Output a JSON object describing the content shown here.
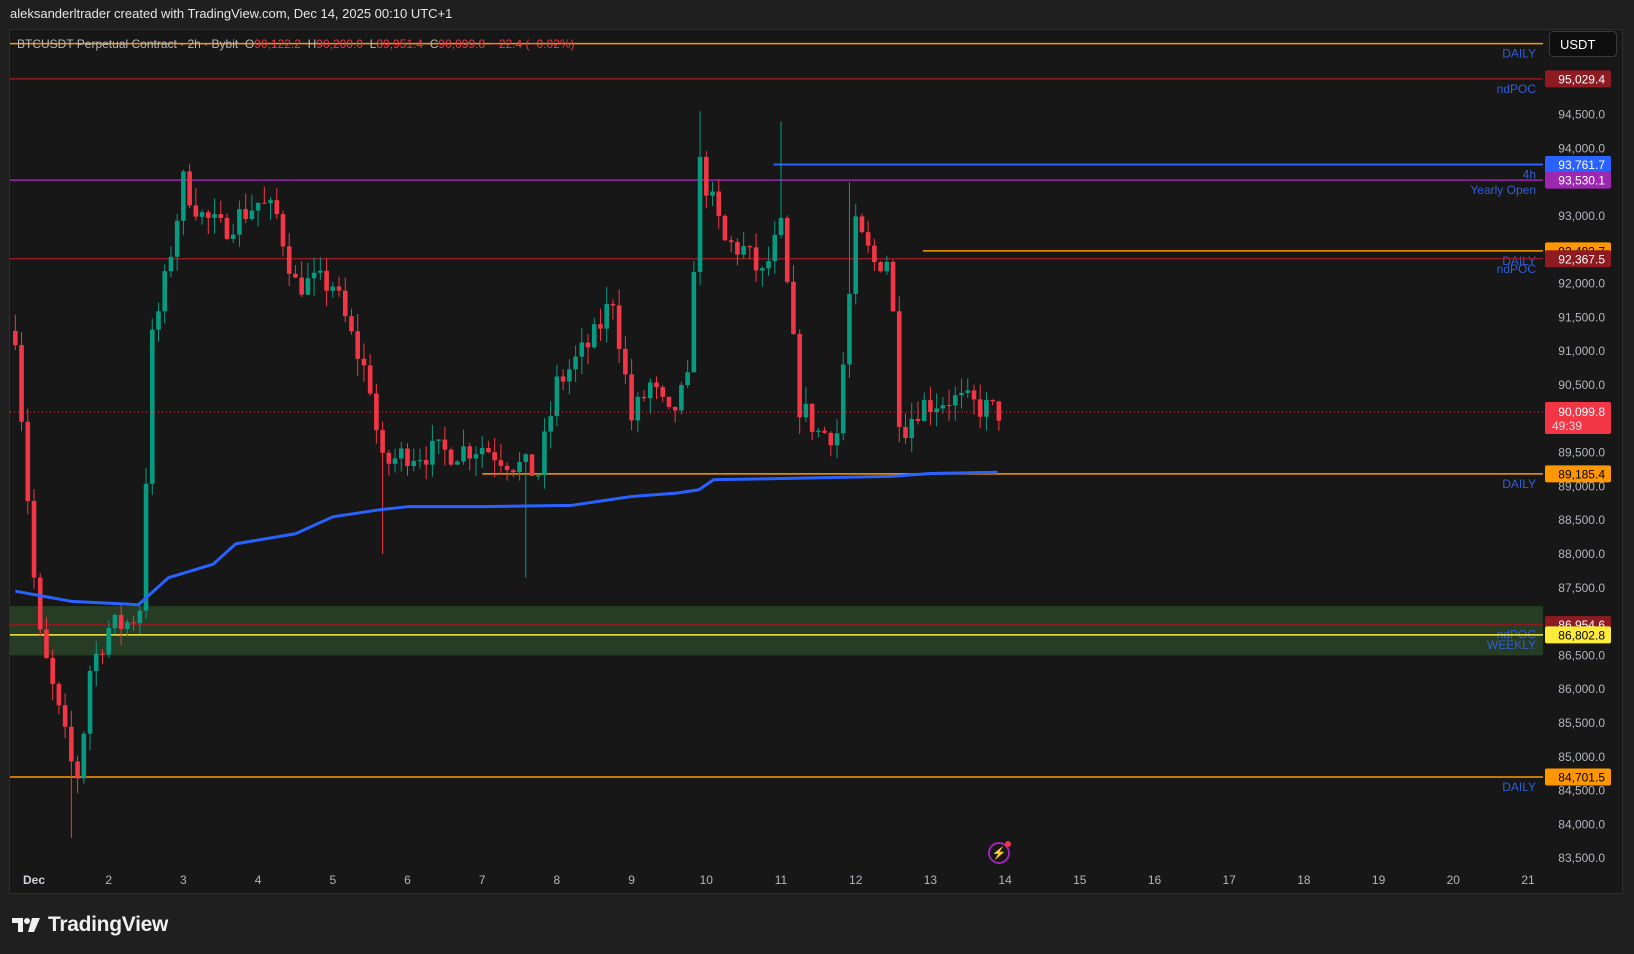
{
  "attribution": "aleksanderltrader created with TradingView.com, Dec 14, 2025 00:10 UTC+1",
  "legend": {
    "symbol": "BTCUSDT Perpetual Contract · 2h · Bybit",
    "o_label": "O",
    "o": "90,122.2",
    "h_label": "H",
    "h": "90,200.0",
    "l_label": "L",
    "l": "89,951.4",
    "c_label": "C",
    "c": "90,099.8",
    "change": "−22.4 (−0.02%)"
  },
  "currency": "USDT",
  "price_axis": [
    "94,500.0",
    "94,000.0",
    "93,500.0",
    "93,000.0",
    "92,500.0",
    "92,000.0",
    "91,500.0",
    "91,000.0",
    "90,500.0",
    "90,000.0",
    "89,500.0",
    "89,000.0",
    "88,500.0",
    "88,000.0",
    "87,500.0",
    "87,000.0",
    "86,500.0",
    "86,000.0",
    "85,500.0",
    "85,000.0",
    "84,500.0",
    "84,000.0",
    "83,500.0"
  ],
  "time_axis": [
    "Dec",
    "2",
    "3",
    "4",
    "5",
    "6",
    "7",
    "8",
    "9",
    "10",
    "11",
    "12",
    "13",
    "14",
    "15",
    "16",
    "17",
    "18",
    "19",
    "20",
    "21"
  ],
  "levels": [
    {
      "price": 95550,
      "tag": "",
      "label": "DAILY",
      "color": "#ff9800",
      "text_color": "#000000",
      "start_day": null
    },
    {
      "price": 95029.4,
      "tag": "95,029.4",
      "label": "ndPOC",
      "color": "#8e1b22",
      "text_color": "#ffffff",
      "start_day": null
    },
    {
      "price": 93761.7,
      "tag": "93,761.7",
      "label": "4h",
      "color": "#2962ff",
      "text_color": "#ffffff",
      "start_day": 9.9
    },
    {
      "price": 93530.1,
      "tag": "93,530.1",
      "label": "Yearly Open",
      "color": "#9c27b0",
      "text_color": "#ffffff",
      "start_day": null
    },
    {
      "price": 92483.7,
      "tag": "92,483.7",
      "label": "DAILY",
      "color": "#ff9800",
      "text_color": "#000000",
      "start_day": 11.9
    },
    {
      "price": 92367.5,
      "tag": "92,367.5",
      "label": "ndPOC",
      "color": "#8e1b22",
      "text_color": "#ffffff",
      "start_day": null
    },
    {
      "price": 89185.4,
      "tag": "89,185.4",
      "label": "DAILY",
      "color": "#ff9800",
      "text_color": "#000000",
      "start_day": 6.0
    },
    {
      "price": 86954.6,
      "tag": "86,954.6",
      "label": "ndPOC",
      "color": "#8e1b22",
      "text_color": "#ffffff",
      "start_day": null
    },
    {
      "price": 86802.8,
      "tag": "86,802.8",
      "label": "WEEKLY",
      "color": "#ffeb3b",
      "text_color": "#000000",
      "start_day": null
    },
    {
      "price": 84701.5,
      "tag": "84,701.5",
      "label": "DAILY",
      "color": "#ff9800",
      "text_color": "#000000",
      "start_day": null
    }
  ],
  "zone": {
    "from": 86500,
    "to": 87230,
    "color": "#2c4a2a"
  },
  "current": {
    "price": 90099.8,
    "price_text": "90,099.8",
    "countdown": "49:39",
    "color": "#f23645"
  },
  "colors": {
    "up": "#089981",
    "down": "#f23645",
    "vwap": "#2962ff"
  },
  "chart_data": {
    "type": "candlestick",
    "interval": "2h",
    "ylim": [
      83300,
      95700
    ],
    "close_path": [
      [
        -0.25,
        91300
      ],
      [
        0.05,
        86900
      ],
      [
        0.25,
        86000
      ],
      [
        0.5,
        84900
      ],
      [
        0.6,
        84700
      ],
      [
        0.75,
        86300
      ],
      [
        1.0,
        86900
      ],
      [
        1.3,
        87000
      ],
      [
        1.45,
        87300
      ],
      [
        1.55,
        91000
      ],
      [
        1.75,
        92000
      ],
      [
        2.0,
        93500
      ],
      [
        2.25,
        93000
      ],
      [
        2.5,
        92800
      ],
      [
        3.0,
        93200
      ],
      [
        3.25,
        93000
      ],
      [
        3.5,
        92000
      ],
      [
        3.75,
        92000
      ],
      [
        4.0,
        92000
      ],
      [
        4.25,
        91200
      ],
      [
        4.5,
        90500
      ],
      [
        4.65,
        89300
      ],
      [
        5.0,
        89500
      ],
      [
        5.5,
        89500
      ],
      [
        6.0,
        89600
      ],
      [
        6.5,
        89300
      ],
      [
        6.75,
        89200
      ],
      [
        7.0,
        90500
      ],
      [
        7.5,
        91200
      ],
      [
        7.75,
        91800
      ],
      [
        8.0,
        90000
      ],
      [
        8.25,
        90500
      ],
      [
        8.5,
        90000
      ],
      [
        8.75,
        90500
      ],
      [
        8.9,
        93800
      ],
      [
        9.25,
        92600
      ],
      [
        9.5,
        92500
      ],
      [
        9.75,
        92100
      ],
      [
        10.0,
        92800
      ],
      [
        10.25,
        90200
      ],
      [
        10.5,
        89800
      ],
      [
        10.75,
        89800
      ],
      [
        11.0,
        92800
      ],
      [
        11.25,
        92300
      ],
      [
        11.45,
        92400
      ],
      [
        11.6,
        89800
      ],
      [
        11.85,
        90200
      ],
      [
        12.25,
        90300
      ],
      [
        12.9,
        90100
      ]
    ],
    "wicks": [
      [
        0.5,
        "low",
        83800
      ],
      [
        8.95,
        "high",
        94550
      ],
      [
        10.0,
        "high",
        94400
      ],
      [
        6.6,
        "low",
        87650
      ],
      [
        10.95,
        "high",
        93500
      ],
      [
        4.7,
        "low",
        88000
      ]
    ],
    "vwap": [
      [
        -0.25,
        87450
      ],
      [
        0.5,
        87300
      ],
      [
        1.4,
        87250
      ],
      [
        1.8,
        87650
      ],
      [
        2.4,
        87850
      ],
      [
        2.7,
        88150
      ],
      [
        3.5,
        88300
      ],
      [
        4.0,
        88550
      ],
      [
        4.6,
        88650
      ],
      [
        5.0,
        88700
      ],
      [
        6.0,
        88700
      ],
      [
        7.2,
        88720
      ],
      [
        8.0,
        88850
      ],
      [
        8.6,
        88900
      ],
      [
        8.9,
        88950
      ],
      [
        9.1,
        89100
      ],
      [
        10.2,
        89120
      ],
      [
        11.5,
        89150
      ],
      [
        12.0,
        89190
      ],
      [
        12.9,
        89210
      ]
    ]
  },
  "brand": "TradingView"
}
